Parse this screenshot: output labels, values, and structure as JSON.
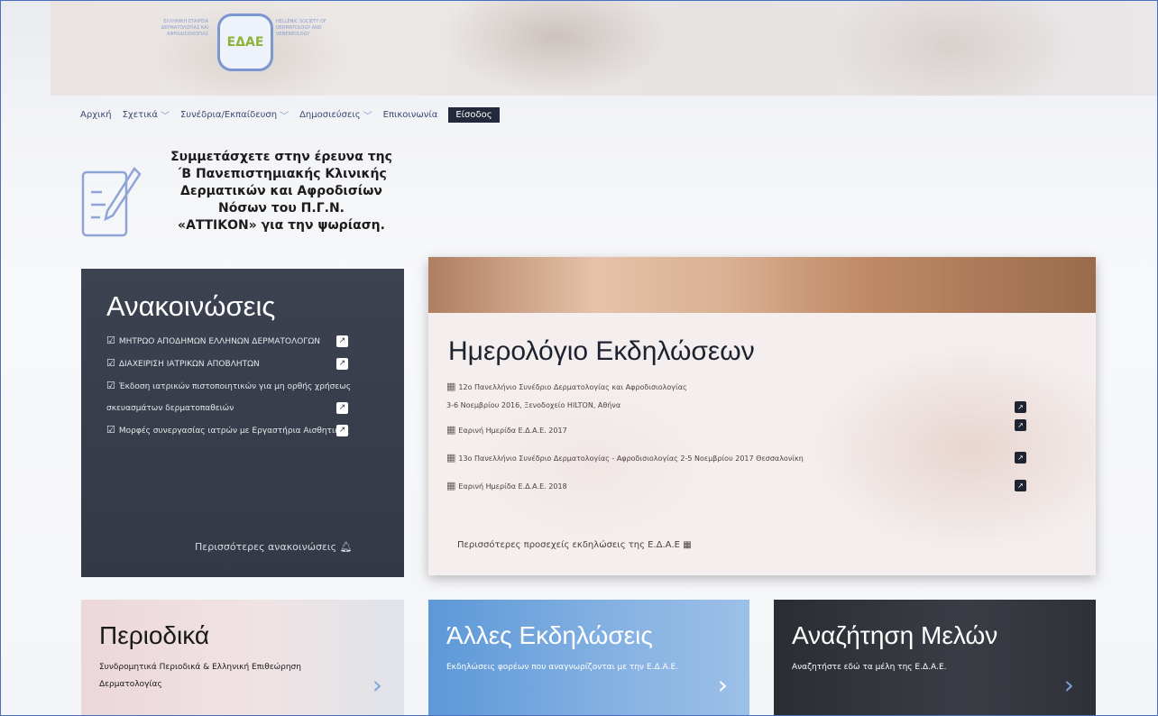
{
  "logo": {
    "left_text": "ΕΛΛΗΝΙΚΗ ΕΤΑΙΡΕΙΑ ΔΕΡΜΑΤΟΛΟΓΙΑΣ ΚΑΙ ΑΦΡΟΔΙΣΙΟΛΟΓΙΑΣ",
    "mark": "ΕΔΑΕ",
    "right_text": "HELLENIC SOCIETY OF DERMATOLOGY AND VENEREOLOGY"
  },
  "nav": {
    "items": [
      {
        "label": "Αρχική",
        "has_dropdown": false
      },
      {
        "label": "Σχετικά",
        "has_dropdown": true
      },
      {
        "label": "Συνέδρια/Εκπαίδευση",
        "has_dropdown": true
      },
      {
        "label": "Δημοσιεύσεις",
        "has_dropdown": true
      },
      {
        "label": "Επικοινωνία",
        "has_dropdown": false
      },
      {
        "label": "Είσοδος",
        "has_dropdown": false,
        "active": true
      }
    ]
  },
  "survey": {
    "lines": [
      "Συμμετάσχετε στην έρευνα της",
      "΄Β Πανεπιστημιακής Κλινικής",
      "Δερματικών και Αφροδισίων",
      "Νόσων του Π.Γ.Ν.",
      "«ΑΤΤΙΚΟΝ» για την ψωρίαση."
    ]
  },
  "announcements": {
    "title": "Ανακοινώσεις",
    "items": [
      "ΜΗΤΡΩΟ ΑΠΟΔΗΜΩΝ ΕΛΛΗΝΩΝ ΔΕΡΜΑΤΟΛΟΓΩΝ",
      "ΔΙΑΧΕΙΡΙΣΗ ΙΑΤΡΙΚΩΝ ΑΠΟΒΛΗΤΩΝ",
      "Έκδοση ιατρικών πιστοποιητικών για μη ορθής χρήσεως σκευασμάτων δερματοπαθειών",
      "Μορφές συνεργασίας ιατρών με Εργαστήρια Αισθητικής"
    ],
    "more": "Περισσότερες ανακοινώσεις"
  },
  "calendar": {
    "title": "Ημερολόγιο Εκδηλώσεων",
    "events": [
      {
        "line1": "12ο Πανελλήνιο Συνέδριο Δερματολογίας και Αφροδισιολογίας",
        "line2": "3-6 Νοεμβρίου 2016, Ξενοδοχείο HILTON, Αθήνα"
      },
      {
        "line1": "Εαρινή Ημερίδα Ε.Δ.Α.Ε. 2017",
        "line2": ""
      },
      {
        "line1": "13ο Πανελλήνιο Συνέδριο Δερματολογίας - Αφροδισιολογίας 2-5 Νοεμβρίου 2017 Θεσσαλονίκη",
        "line2": ""
      },
      {
        "line1": "Εαρινή Ημερίδα Ε.Δ.Α.Ε. 2018",
        "line2": ""
      }
    ],
    "more": "Περισσότερες προσεχείς εκδηλώσεις της Ε.Δ.Α.Ε"
  },
  "tiles": [
    {
      "title": "Περιοδικά",
      "text": "Συνδρομητικά Περιοδικά & Ελληνική Επιθεώρηση Δερματολογίας"
    },
    {
      "title": "Άλλες Εκδηλώσεις",
      "text": "Εκδηλώσεις φορέων που αναγνωρίζονται με την Ε.Δ.Α.Ε."
    },
    {
      "title": "Αναζήτηση Μελών",
      "text": "Αναζητήστε εδώ τα μέλη της Ε.Δ.Α.Ε."
    }
  ],
  "colors": {
    "nav_active_bg": "#232a3b",
    "logo_blue": "#7b96d1",
    "logo_green": "#8db33a",
    "announcements_bg": "#3c4250",
    "tile_blue": "#5d98d8",
    "tile_dark": "#2b2d34"
  },
  "icons": {
    "nav_dropdown": "chevron-down-icon",
    "announcement_item": "checkbox-icon",
    "external_link": "external-link-icon",
    "announcements_more": "bell-icon",
    "calendar_item": "calendar-icon",
    "tile_arrow": "chevron-right-icon",
    "survey": "survey-document-icon"
  }
}
